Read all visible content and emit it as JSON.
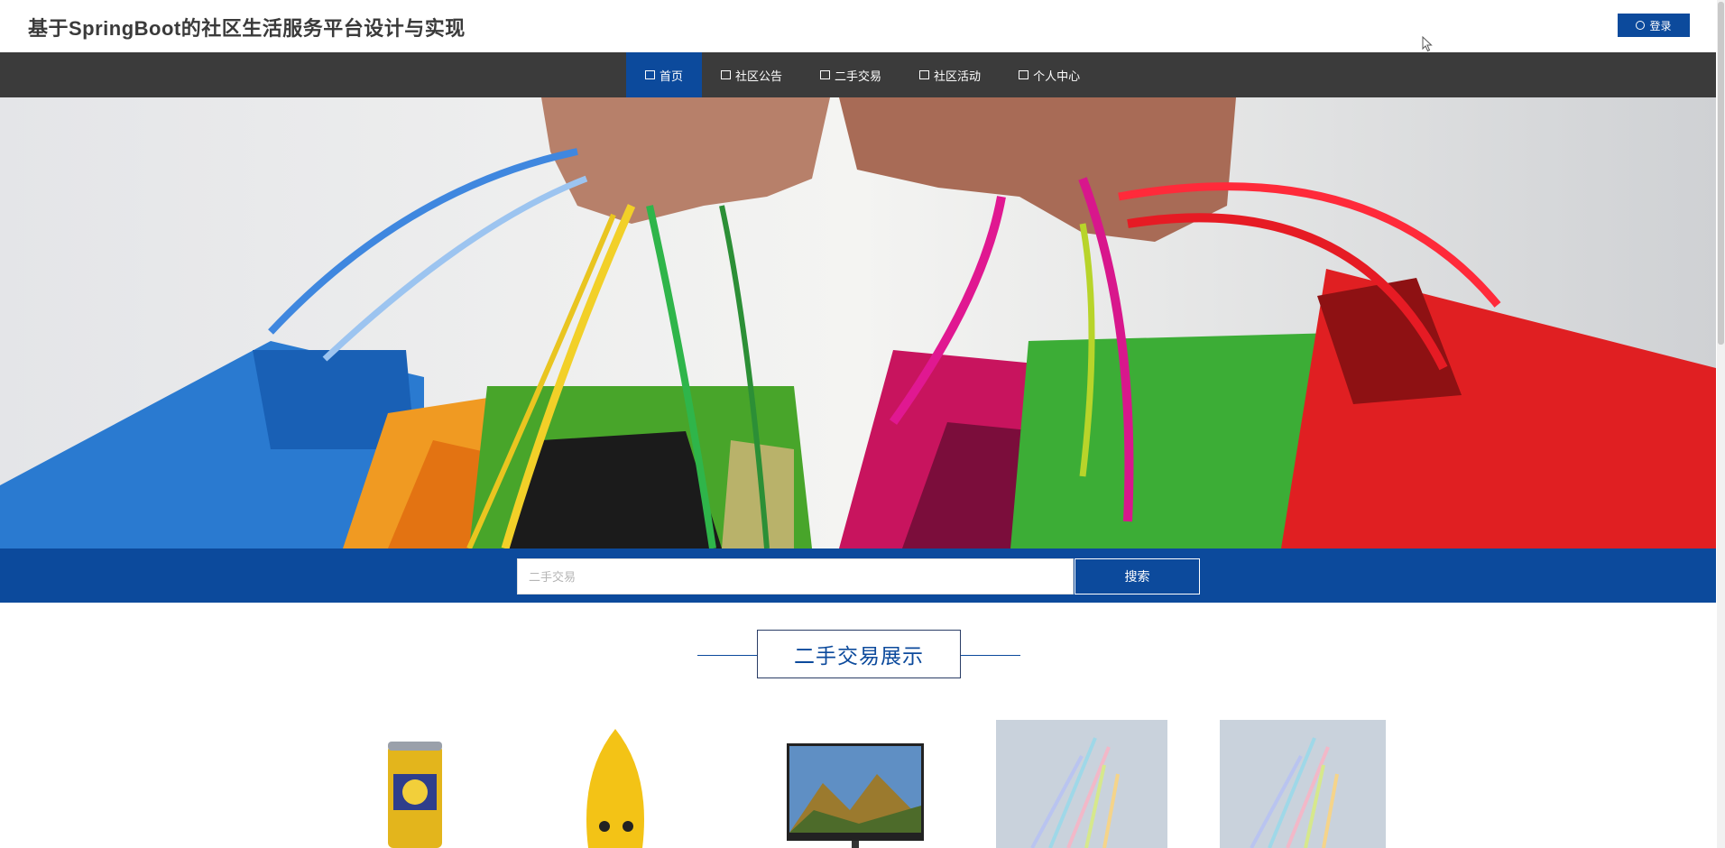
{
  "header": {
    "site_title": "基于SpringBoot的社区生活服务平台设计与实现",
    "login_label": "登录"
  },
  "nav": {
    "items": [
      {
        "label": "首页",
        "active": true,
        "icon": "home-icon"
      },
      {
        "label": "社区公告",
        "active": false,
        "icon": "notice-icon"
      },
      {
        "label": "二手交易",
        "active": false,
        "icon": "trade-icon"
      },
      {
        "label": "社区活动",
        "active": false,
        "icon": "activity-icon"
      },
      {
        "label": "个人中心",
        "active": false,
        "icon": "user-icon"
      }
    ]
  },
  "search": {
    "placeholder": "二手交易",
    "button_label": "搜索"
  },
  "section": {
    "title": "二手交易展示"
  },
  "products": [
    {
      "name": "product-can",
      "icon": "can-image"
    },
    {
      "name": "product-toy",
      "icon": "duck-toy-image"
    },
    {
      "name": "product-monitor",
      "icon": "monitor-image"
    },
    {
      "name": "product-pens-1",
      "icon": "pens-image"
    },
    {
      "name": "product-pens-2",
      "icon": "pens-image"
    }
  ],
  "colors": {
    "brand": "#0c4a9c",
    "nav_bg": "#3b3b3b"
  }
}
